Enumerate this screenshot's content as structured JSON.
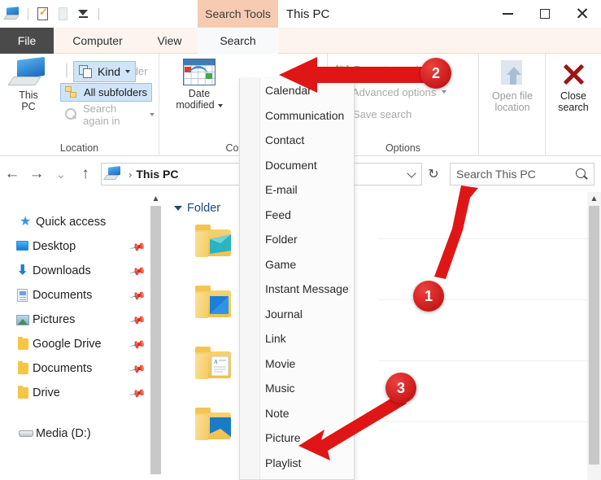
{
  "window": {
    "title": "This PC",
    "contextual_tab": "Search Tools",
    "minimize": "minimize",
    "maximize": "maximize",
    "close": "close",
    "help": "?"
  },
  "quick_access_toolbar": {
    "items": [
      "this-pc-icon",
      "properties-icon",
      "new-folder-icon",
      "customize-caret-icon"
    ]
  },
  "ribbon_tabs": [
    {
      "label": "File",
      "id": "file"
    },
    {
      "label": "Computer",
      "id": "computer"
    },
    {
      "label": "View",
      "id": "view"
    },
    {
      "label": "Search",
      "id": "search"
    }
  ],
  "ribbon": {
    "groups": [
      {
        "label": "Location",
        "this_pc": "This\nPC",
        "this_pc_line1": "This",
        "this_pc_line2": "PC",
        "current_folder": "Current folder",
        "all_subfolders": "All subfolders",
        "search_again_in": "Search again in"
      },
      {
        "label": "Contact",
        "date_modified_line1": "Date",
        "date_modified_line2": "modified",
        "kind": "Kind"
      },
      {
        "label": "Options",
        "recent_searches": "Recent searches",
        "advanced_options": "Advanced options",
        "save_search": "Save search"
      },
      {
        "label": "",
        "open_file_location_line1": "Open file",
        "open_file_location_line2": "location"
      },
      {
        "label": "",
        "close_search_line1": "Close",
        "close_search_line2": "search"
      }
    ]
  },
  "address_bar": {
    "back": "←",
    "forward": "→",
    "recent_caret": "⌄",
    "up": "↑",
    "path_root": "This PC",
    "path_separator": "›",
    "refresh": "↻",
    "search_placeholder": "Search This PC"
  },
  "navigation_pane": {
    "items": [
      {
        "label": "Quick access",
        "icon": "star-icon",
        "pinned": false,
        "root": true
      },
      {
        "label": "Desktop",
        "icon": "desktop-icon",
        "pinned": true
      },
      {
        "label": "Downloads",
        "icon": "downloads-icon",
        "pinned": true
      },
      {
        "label": "Documents",
        "icon": "documents-icon",
        "pinned": true
      },
      {
        "label": "Pictures",
        "icon": "pictures-icon",
        "pinned": true
      },
      {
        "label": "Google Drive",
        "icon": "folder-icon",
        "pinned": true
      },
      {
        "label": "Documents",
        "icon": "folder-icon",
        "pinned": true
      },
      {
        "label": "Drive",
        "icon": "folder-icon",
        "pinned": true
      },
      {
        "label": "Media (D:)",
        "icon": "drive-icon",
        "pinned": false,
        "root": true
      }
    ],
    "pin_glyph": "📌"
  },
  "content": {
    "group_header": "Folder",
    "folder_count": 4
  },
  "kind_dropdown": {
    "items": [
      "Calendar",
      "Communication",
      "Contact",
      "Document",
      "E-mail",
      "Feed",
      "Folder",
      "Game",
      "Instant Message",
      "Journal",
      "Link",
      "Movie",
      "Music",
      "Note",
      "Picture",
      "Playlist"
    ]
  },
  "annotations": [
    {
      "number": "1",
      "target": "search-box"
    },
    {
      "number": "2",
      "target": "kind-button"
    },
    {
      "number": "3",
      "target": "picture-menu-item"
    }
  ],
  "colors": {
    "contextual_tab": "#f7cbb2",
    "file_tab": "#4a4a4a",
    "annotation_red": "#d11919",
    "selection_blue": "#cfe4f7",
    "group_header_blue": "#1b4b7e"
  }
}
